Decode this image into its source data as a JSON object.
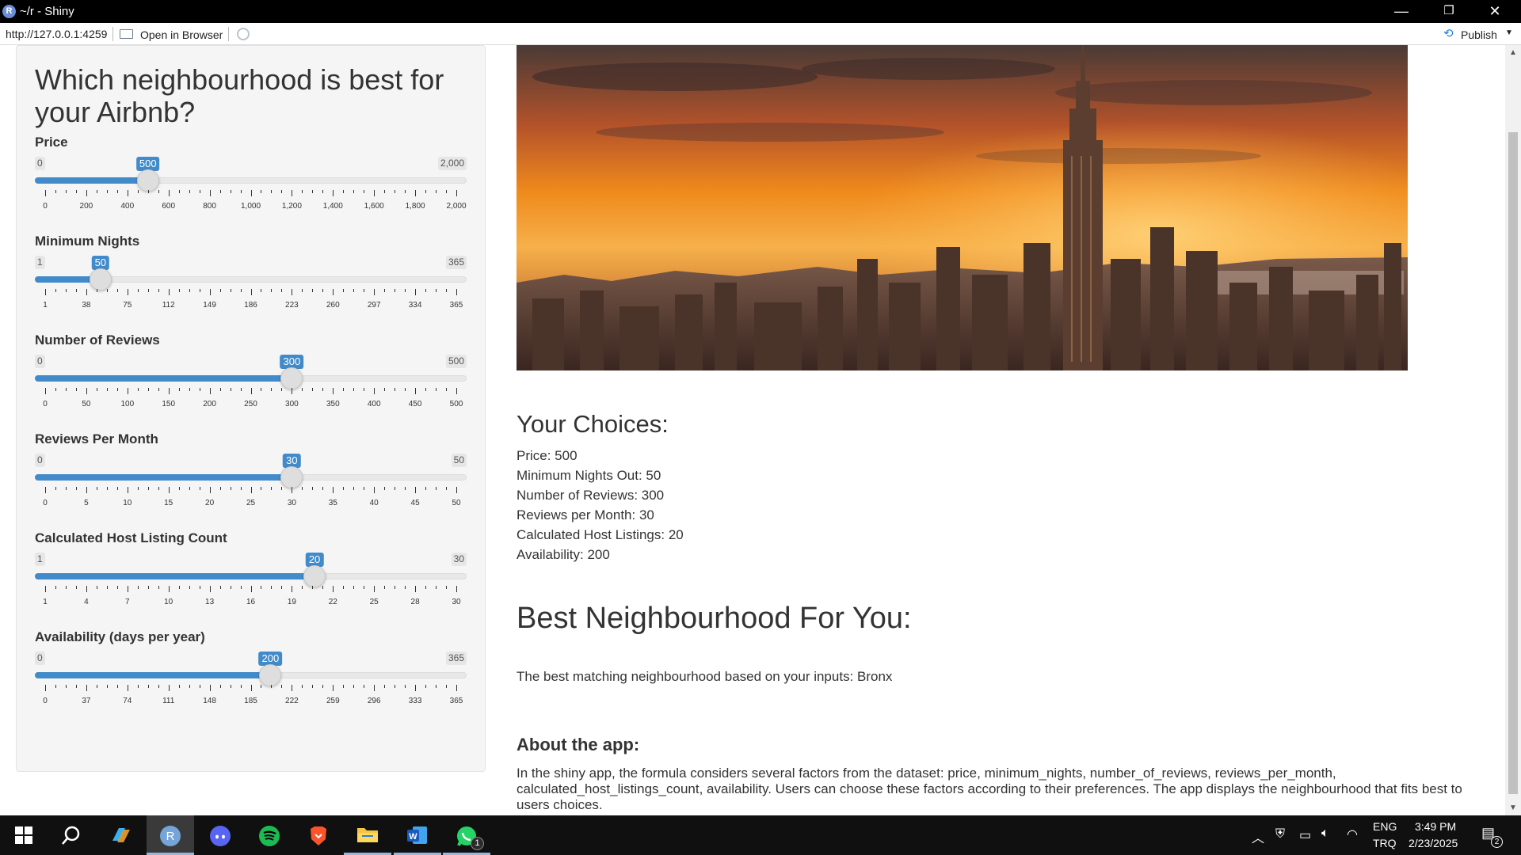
{
  "window": {
    "title": "~/r - Shiny",
    "app_icon": "R",
    "minimize": "—",
    "maximize": "❐",
    "close": "✕"
  },
  "toolbar": {
    "url": "http://127.0.0.1:4259",
    "open_in_browser": "Open in Browser",
    "publish": "Publish"
  },
  "sidebar": {
    "title": "Which neighbourhood is best for your Airbnb?",
    "sliders": [
      {
        "label": "Price",
        "min": "0",
        "max": "2,000",
        "value": "500",
        "fraction": 0.25,
        "ticks": [
          "0",
          "200",
          "400",
          "600",
          "800",
          "1,000",
          "1,200",
          "1,400",
          "1,600",
          "1,800",
          "2,000"
        ]
      },
      {
        "label": "Minimum Nights",
        "min": "1",
        "max": "365",
        "value": "50",
        "fraction": 0.1346,
        "ticks": [
          "1",
          "38",
          "75",
          "112",
          "149",
          "186",
          "223",
          "260",
          "297",
          "334",
          "365"
        ]
      },
      {
        "label": "Number of Reviews",
        "min": "0",
        "max": "500",
        "value": "300",
        "fraction": 0.6,
        "ticks": [
          "0",
          "50",
          "100",
          "150",
          "200",
          "250",
          "300",
          "350",
          "400",
          "450",
          "500"
        ]
      },
      {
        "label": "Reviews Per Month",
        "min": "0",
        "max": "50",
        "value": "30",
        "fraction": 0.6,
        "ticks": [
          "0",
          "5",
          "10",
          "15",
          "20",
          "25",
          "30",
          "35",
          "40",
          "45",
          "50"
        ]
      },
      {
        "label": "Calculated Host Listing Count",
        "min": "1",
        "max": "30",
        "value": "20",
        "fraction": 0.6552,
        "ticks": [
          "1",
          "4",
          "7",
          "10",
          "13",
          "16",
          "19",
          "22",
          "25",
          "28",
          "30"
        ]
      },
      {
        "label": "Availability (days per year)",
        "min": "0",
        "max": "365",
        "value": "200",
        "fraction": 0.5479,
        "ticks": [
          "0",
          "37",
          "74",
          "111",
          "148",
          "185",
          "222",
          "259",
          "296",
          "333",
          "365"
        ]
      }
    ]
  },
  "main": {
    "choices_heading": "Your Choices:",
    "choices": [
      "Price: 500",
      "Minimum Nights Out: 50",
      "Number of Reviews: 300",
      "Reviews per Month: 30",
      "Calculated Host Listings: 20",
      "Availability: 200"
    ],
    "best_heading": "Best Neighbourhood For You:",
    "result": "The best matching neighbourhood based on your inputs: Bronx",
    "about_heading": "About the app:",
    "about_text": "In the shiny app, the formula considers several factors from the dataset: price, minimum_nights, number_of_reviews, reviews_per_month, calculated_host_listings_count, availability. Users can choose these factors according to their preferences. The app displays the neighbourhood that fits best to users choices."
  },
  "taskbar": {
    "apps": [
      "windows-start",
      "search",
      "copilot",
      "rstudio",
      "discord",
      "spotify",
      "brave",
      "file-explorer",
      "word",
      "whatsapp"
    ],
    "whatsapp_badge": "1",
    "lang_top": "ENG",
    "lang_bottom": "TRQ",
    "time": "3:49 PM",
    "date": "2/23/2025",
    "notif_count": "2"
  },
  "colors": {
    "accent": "#428bca",
    "sidebar_bg": "#f5f5f5",
    "titlebar": "#000000",
    "taskbar": "#101010"
  }
}
